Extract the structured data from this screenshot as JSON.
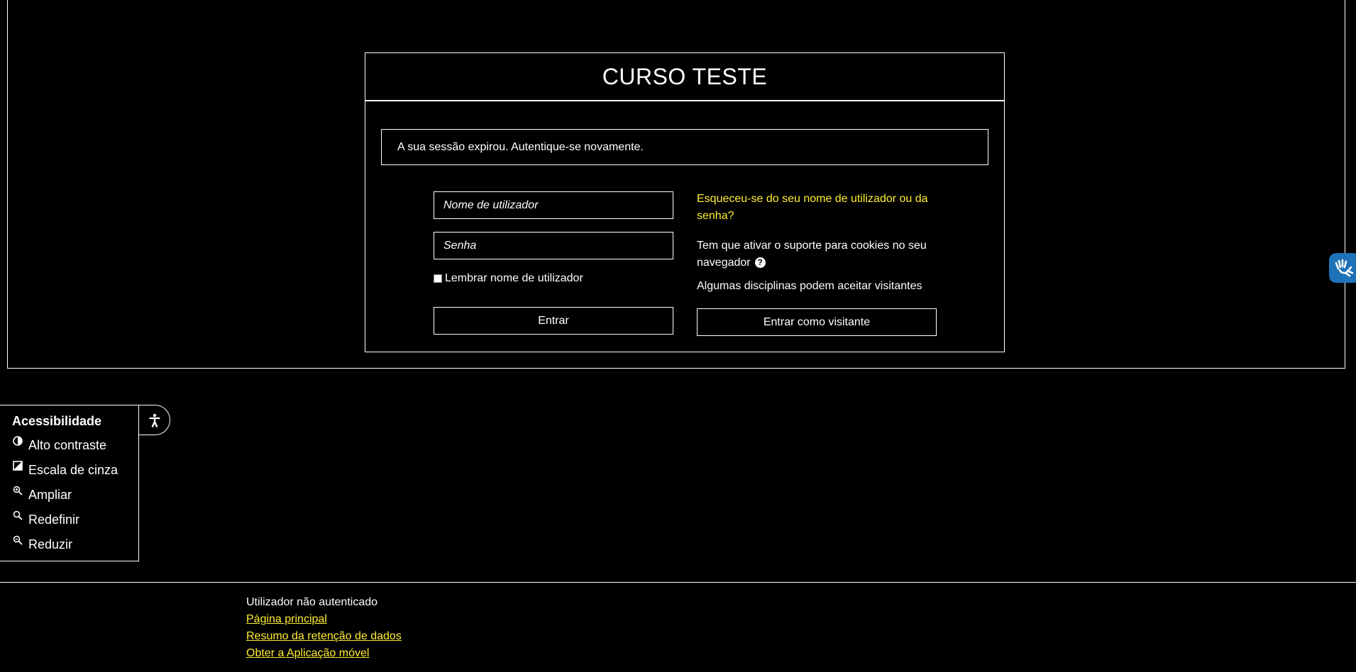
{
  "course": {
    "title": "CURSO TESTE"
  },
  "alert": {
    "message": "A sua sessão expirou. Autentique-se novamente."
  },
  "login": {
    "username_placeholder": "Nome de utilizador",
    "password_placeholder": "Senha",
    "remember_label": "Lembrar nome de utilizador",
    "submit_label": "Entrar"
  },
  "help": {
    "forgot_link": "Esqueceu-se do seu nome de utilizador ou da senha?",
    "cookies_notice": "Tem que ativar o suporte para cookies no seu navegador",
    "guest_notice": "Algumas disciplinas podem aceitar visitantes",
    "guest_button": "Entrar como visitante"
  },
  "accessibility": {
    "title": "Acessibilidade",
    "items": [
      {
        "label": "Alto contraste",
        "icon": "contrast-icon"
      },
      {
        "label": "Escala de cinza",
        "icon": "grayscale-icon"
      },
      {
        "label": "Ampliar",
        "icon": "zoom-in-icon"
      },
      {
        "label": "Redefinir",
        "icon": "zoom-reset-icon"
      },
      {
        "label": "Reduzir",
        "icon": "zoom-out-icon"
      }
    ],
    "toggle_icon": "accessibility-person-icon"
  },
  "vlibras": {
    "icon": "sign-language-hands-icon",
    "color": "#1e72b8"
  },
  "footer": {
    "status": "Utilizador não autenticado",
    "links": [
      "Página principal",
      "Resumo da retenção de dados",
      "Obter a Aplicação móvel"
    ]
  },
  "colors": {
    "background": "#000000",
    "text": "#ffffff",
    "link": "#ffee33"
  }
}
